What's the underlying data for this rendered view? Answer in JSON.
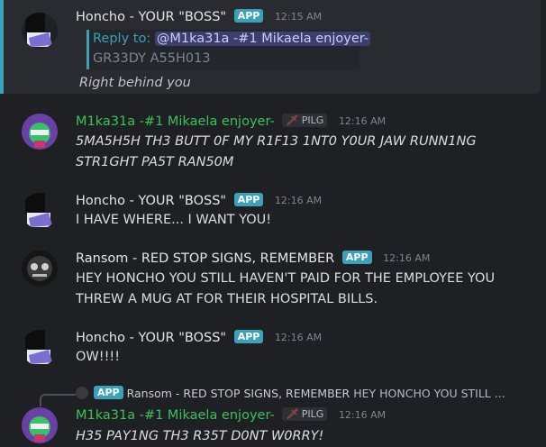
{
  "colors": {
    "background": "#1f2023",
    "app_badge": "#3aa1b9",
    "mika_name": "#36c35a",
    "boss_name": "#e6e6e6",
    "mention": "#c9cdfb"
  },
  "badges": {
    "app": "APP",
    "pilg": "PILG"
  },
  "messages": [
    {
      "author": "Honcho - YOUR \"BOSS\"",
      "time": "12:15 AM",
      "reply_prefix": "Reply to:",
      "reply_mention": "@M1ka31a -#1 Mikaela enjoyer-",
      "reply_text": "GR33DY A55H013",
      "text": "Right behind you"
    },
    {
      "author": "M1ka31a -#1 Mikaela enjoyer-",
      "time": "12:16 AM",
      "line1": "5MA5H5H TH3 BUTT 0F MY R1F13 1NT0 Y0UR JAW RUNN1NG",
      "line2": "STR1GHT PA5T RAN50M"
    },
    {
      "author": "Honcho - YOUR \"BOSS\"",
      "time": "12:16 AM",
      "text": "I HAVE WHERE... I WANT YOU!"
    },
    {
      "author": "Ransom - RED STOP SIGNS, REMEMBER",
      "time": "12:16 AM",
      "line1": "HEY HONCHO YOU STILL HAVEN'T PAID FOR THE EMPLOYEE YOU",
      "line2": "THREW A MUG AT FOR THEIR HOSPITAL BILLS."
    },
    {
      "author": "Honcho - YOUR \"BOSS\"",
      "time": "12:16 AM",
      "text": "OW!!!!"
    },
    {
      "reply_author": "Ransom - RED STOP SIGNS, REMEMBER",
      "reply_snippet": "HEY HONCHO YOU STILL ...",
      "author": "M1ka31a -#1 Mikaela enjoyer-",
      "time": "12:16 AM",
      "text": "H35 PAY1NG TH3 R35T D0NT W0RRY!"
    }
  ]
}
